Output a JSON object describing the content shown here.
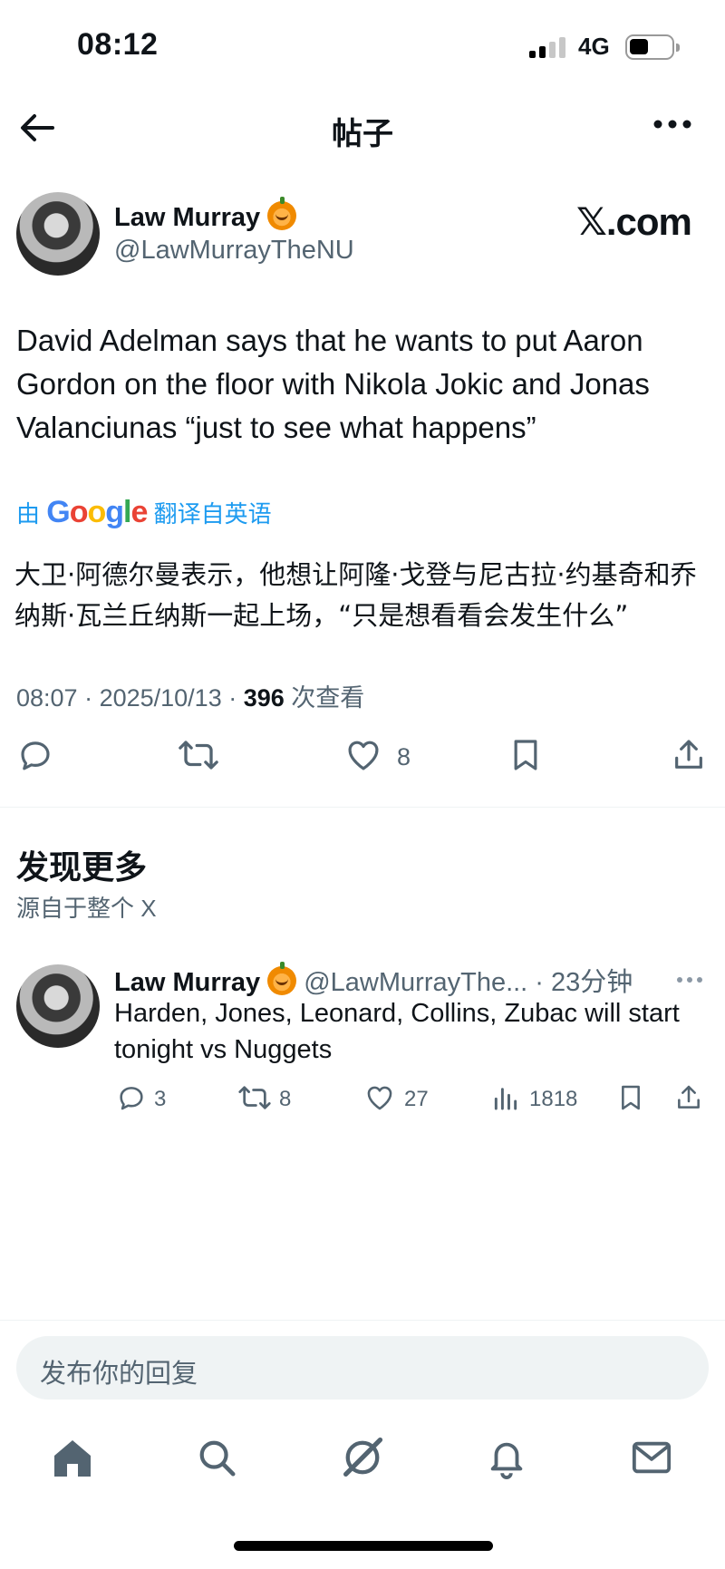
{
  "status_bar": {
    "time": "08:12",
    "network": "4G"
  },
  "nav": {
    "title": "帖子"
  },
  "post": {
    "author_name": "Law Murray",
    "author_handle": "@LawMurrayTheNU",
    "source": "𝕏.com",
    "text": "David Adelman says that he wants to put Aaron Gordon on the floor with Nikola Jokic and Jonas Valanciunas “just to see what happens”",
    "translate_prefix": "由",
    "translate_brand": "Google",
    "translate_suffix": "翻译自英语",
    "translated_text": "大卫·阿德尔曼表示，他想让阿隆·戈登与尼古拉·约基奇和乔纳斯·瓦兰丘纳斯一起上场，“只是想看看会发生什么”",
    "time": "08:07",
    "date": "2025/10/13",
    "views": "396",
    "views_label": "次查看",
    "likes": "8"
  },
  "discover": {
    "title": "发现更多",
    "subtitle": "源自于整个 X",
    "items": [
      {
        "author_name": "Law Murray",
        "author_handle": "@LawMurrayThe...",
        "age": "23分钟",
        "text": "Harden, Jones, Leonard, Collins, Zubac will start tonight vs Nuggets",
        "replies": "3",
        "reposts": "8",
        "likes": "27",
        "views": "1818"
      }
    ]
  },
  "reply": {
    "placeholder": "发布你的回复"
  },
  "icons": [
    "back-arrow-icon",
    "more-icon",
    "reply-icon",
    "repost-icon",
    "like-icon",
    "bookmark-icon",
    "share-icon",
    "views-icon",
    "home-icon",
    "search-icon",
    "grok-icon",
    "notifications-icon",
    "messages-icon"
  ]
}
